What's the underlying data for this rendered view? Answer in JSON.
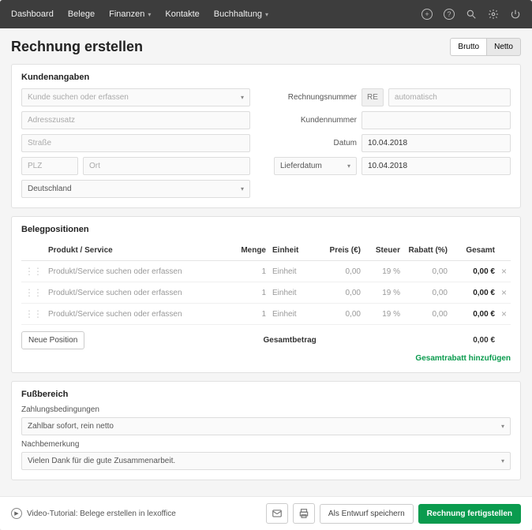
{
  "nav": {
    "dashboard": "Dashboard",
    "belege": "Belege",
    "finanzen": "Finanzen",
    "kontakte": "Kontakte",
    "buchhaltung": "Buchhaltung"
  },
  "page": {
    "title": "Rechnung erstellen",
    "brutto": "Brutto",
    "netto": "Netto"
  },
  "customer": {
    "section_title": "Kundenangaben",
    "search_placeholder": "Kunde suchen oder erfassen",
    "address2_placeholder": "Adresszusatz",
    "street_placeholder": "Straße",
    "zip_placeholder": "PLZ",
    "city_placeholder": "Ort",
    "country": "Deutschland",
    "invoice_number_label": "Rechnungsnummer",
    "invoice_prefix": "RE",
    "invoice_number_placeholder": "automatisch",
    "customer_number_label": "Kundennummer",
    "date_label": "Datum",
    "date_value": "10.04.2018",
    "delivery_date_label": "Lieferdatum",
    "delivery_date_value": "10.04.2018"
  },
  "items": {
    "section_title": "Belegpositionen",
    "col_product": "Produkt / Service",
    "col_qty": "Menge",
    "col_unit": "Einheit",
    "col_price": "Preis (€)",
    "col_tax": "Steuer",
    "col_discount": "Rabatt (%)",
    "col_total": "Gesamt",
    "row_placeholder": "Produkt/Service suchen oder erfassen",
    "rows": [
      {
        "qty": "1",
        "unit": "Einheit",
        "price": "0,00",
        "tax": "19 %",
        "discount": "0,00",
        "total": "0,00 €"
      },
      {
        "qty": "1",
        "unit": "Einheit",
        "price": "0,00",
        "tax": "19 %",
        "discount": "0,00",
        "total": "0,00 €"
      },
      {
        "qty": "1",
        "unit": "Einheit",
        "price": "0,00",
        "tax": "19 %",
        "discount": "0,00",
        "total": "0,00 €"
      }
    ],
    "new_position": "Neue Position",
    "grand_total_label": "Gesamtbetrag",
    "grand_total_value": "0,00 €",
    "add_discount": "Gesamtrabatt hinzufügen"
  },
  "footer_section": {
    "title": "Fußbereich",
    "payment_terms_label": "Zahlungsbedingungen",
    "payment_terms_value": "Zahlbar sofort, rein netto",
    "remark_label": "Nachbemerkung",
    "remark_value": "Vielen Dank für die gute Zusammenarbeit."
  },
  "footer_bar": {
    "tutorial": "Video-Tutorial: Belege erstellen in lexoffice",
    "save_draft": "Als Entwurf speichern",
    "finalize": "Rechnung fertigstellen"
  }
}
